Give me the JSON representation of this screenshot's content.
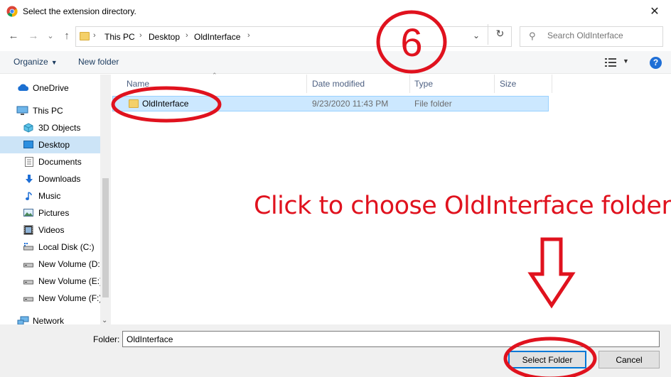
{
  "window": {
    "title": "Select the extension directory.",
    "close_glyph": "✕"
  },
  "nav": {
    "back_glyph": "←",
    "forward_glyph": "→",
    "recent_glyph": "⌄",
    "up_glyph": "↑",
    "breadcrumbs": [
      "This PC",
      "Desktop",
      "OldInterface"
    ],
    "refresh_glyph": "↻",
    "dropdown_glyph": "⌄",
    "search_placeholder": "Search OldInterface",
    "search_icon": "search-icon"
  },
  "toolbar": {
    "organize_label": "Organize",
    "new_folder_label": "New folder",
    "help_label": "?"
  },
  "sidebar": {
    "items": [
      {
        "label": "OneDrive",
        "icon": "cloud-icon"
      },
      {
        "label": "This PC",
        "icon": "computer-icon"
      },
      {
        "label": "3D Objects",
        "icon": "cube-icon"
      },
      {
        "label": "Desktop",
        "icon": "desktop-icon",
        "selected": true
      },
      {
        "label": "Documents",
        "icon": "document-icon"
      },
      {
        "label": "Downloads",
        "icon": "download-icon"
      },
      {
        "label": "Music",
        "icon": "music-icon"
      },
      {
        "label": "Pictures",
        "icon": "picture-icon"
      },
      {
        "label": "Videos",
        "icon": "video-icon"
      },
      {
        "label": "Local Disk (C:)",
        "icon": "drive-icon"
      },
      {
        "label": "New Volume (D:",
        "icon": "drive-icon"
      },
      {
        "label": "New Volume (E:)",
        "icon": "drive-icon"
      },
      {
        "label": "New Volume (F:)",
        "icon": "drive-icon"
      },
      {
        "label": "Network",
        "icon": "network-icon"
      }
    ]
  },
  "filelist": {
    "columns": [
      "Name",
      "Date modified",
      "Type",
      "Size"
    ],
    "rows": [
      {
        "name": "OldInterface",
        "date": "9/23/2020 11:43 PM",
        "type": "File folder",
        "size": ""
      }
    ]
  },
  "footer": {
    "folder_label": "Folder:",
    "folder_value": "OldInterface",
    "select_label": "Select Folder",
    "cancel_label": "Cancel"
  },
  "annotation": {
    "step_number": "6",
    "instruction": "Click to choose OldInterface folder",
    "color": "#e0121e"
  }
}
